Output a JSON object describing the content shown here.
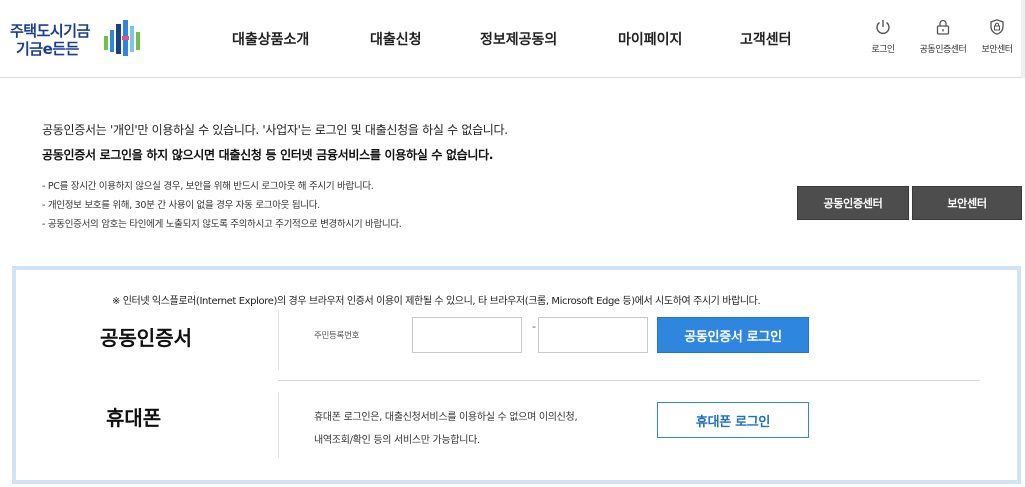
{
  "header": {
    "logo": {
      "line1": "주택도시기금",
      "line2": "기금e든든"
    },
    "nav": [
      "대출상품소개",
      "대출신청",
      "정보제공동의",
      "마이페이지",
      "고객센터"
    ],
    "utils": [
      {
        "label": "로그인",
        "icon": "power-icon"
      },
      {
        "label": "공동인증센터",
        "icon": "lock-icon"
      },
      {
        "label": "보안센터",
        "icon": "shield-icon"
      }
    ]
  },
  "notice": {
    "line1": "공동인증서는 '개인'만 이용하실 수 있습니다. '사업자'는 로그인 및 대출신청을 하실 수 없습니다.",
    "line2": "공동인증서 로그인을 하지 않으시면 대출신청 등 인터넷 금융서비스를 이용하실 수 없습니다.",
    "bullets": [
      "- PC를 장시간 이용하지 않으실 경우, 보안을 위해 반드시 로그아웃 해 주시기 바랍니다.",
      "- 개인정보 보호를 위해, 30분 간 사용이 없을 경우 자동 로그아웃 됩니다.",
      "- 공동인증서의 암호는 타인에게 노출되지 않도록 주의하시고 주기적으로 변경하시기 바랍니다."
    ],
    "buttons": {
      "cert_center": "공동인증센터",
      "security_center": "보안센터"
    }
  },
  "login": {
    "browser_note": "※ 인터넷 익스플로러(Internet Explore)의 경우 브라우저 인증서 이용이 제한될 수 있으니, 타 브라우저(크롬, Microsoft Edge 등)에서 시도하여 주시기 바랍니다.",
    "cert": {
      "title": "공동인증서",
      "field_label": "주민등록번호",
      "ssn_front": "",
      "ssn_back": "",
      "dash": "-",
      "button": "공동인증서 로그인"
    },
    "phone": {
      "title": "휴대폰",
      "desc_line1": "휴대폰 로그인은, 대출신청서비스를 이용하실 수 없으며 이의신청,",
      "desc_line2": "내역조회/확인 등의 서비스만 가능합니다.",
      "button": "휴대폰 로그인"
    }
  },
  "colors": {
    "brand": "#1b3f8f",
    "accent": "#2e86de",
    "panel_border": "#cfe3f4",
    "dark_button": "#4d4d4d"
  }
}
